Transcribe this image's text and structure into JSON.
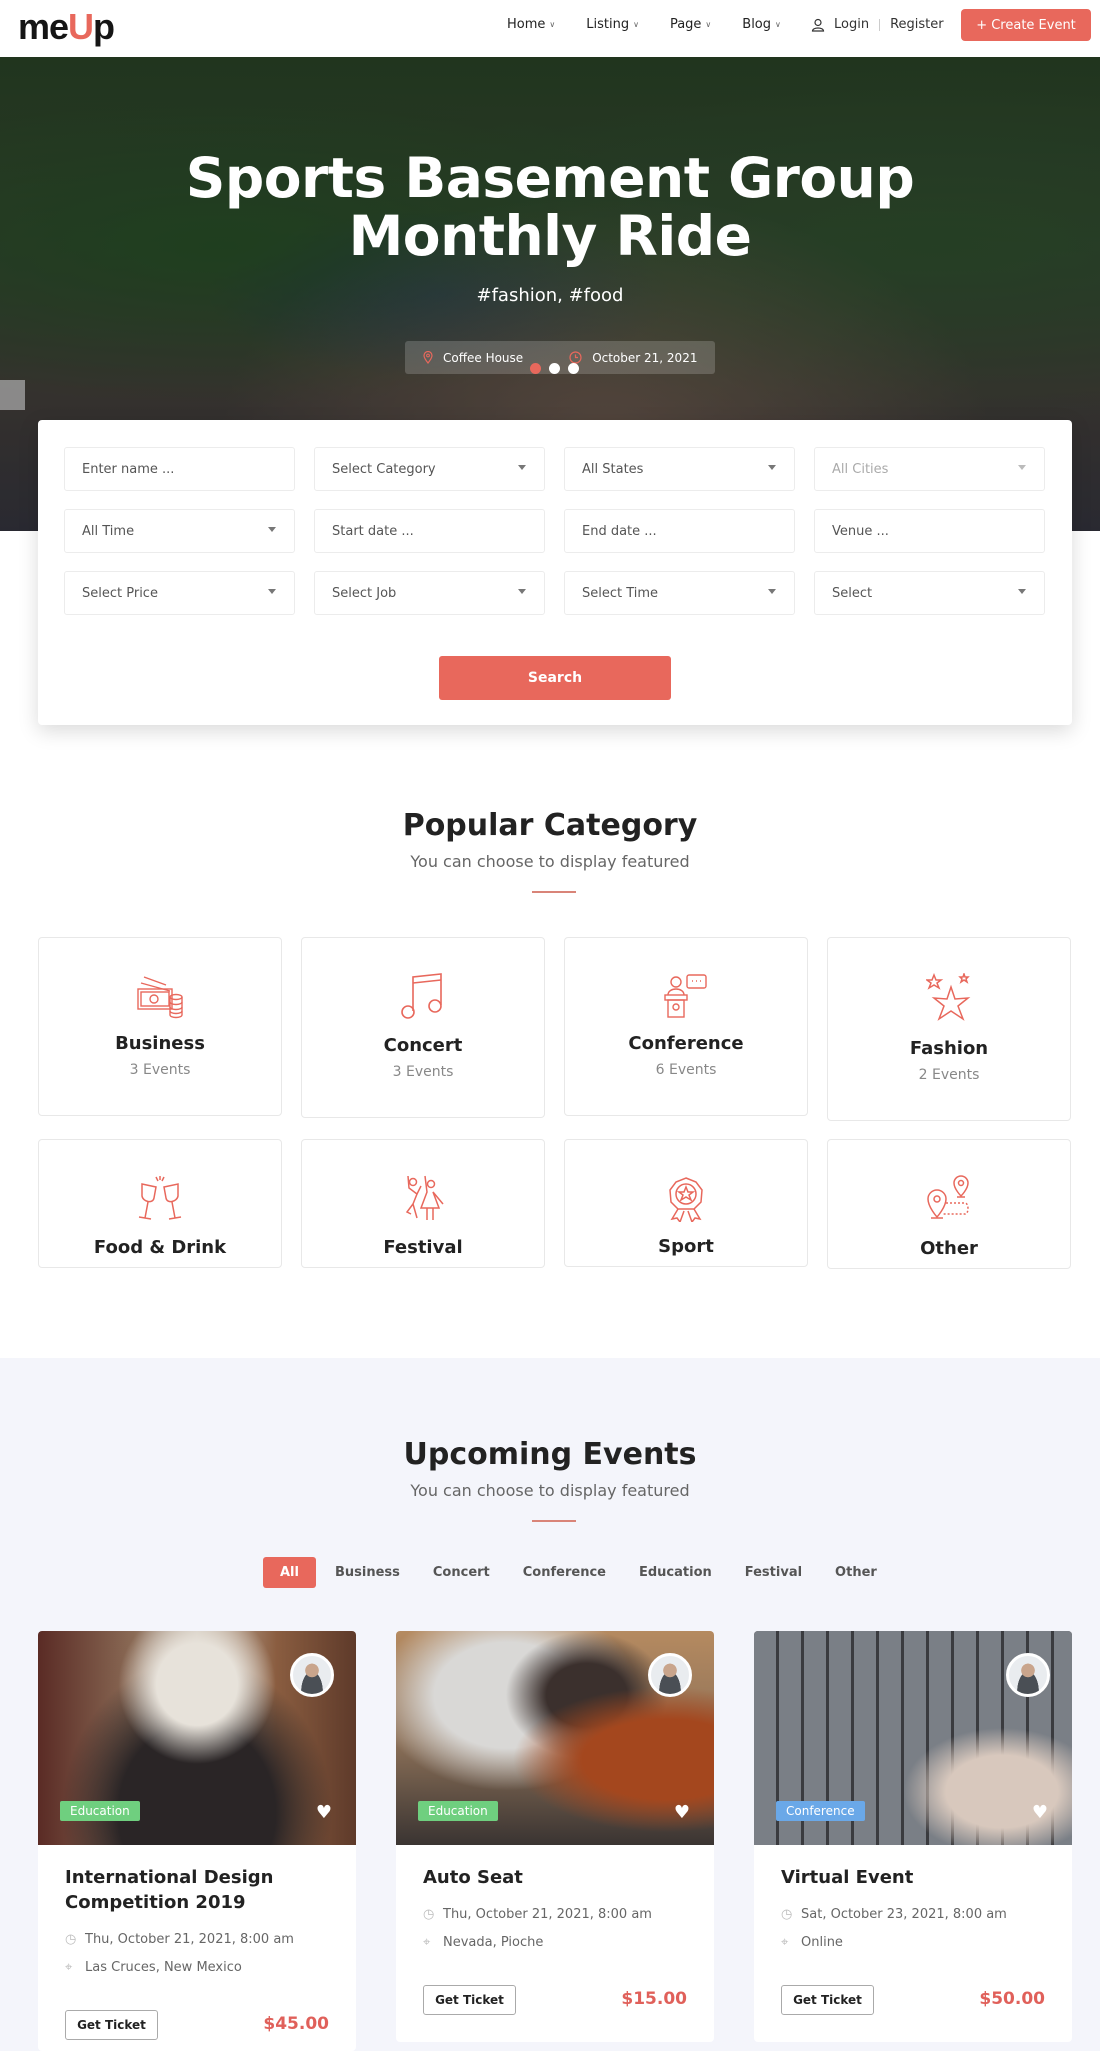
{
  "header": {
    "logo_prefix": "me",
    "logo_accent": "U",
    "logo_suffix": "p",
    "nav": [
      "Home",
      "Listing",
      "Page",
      "Blog"
    ],
    "login": "Login",
    "register": "Register",
    "create_event": "+ Create Event"
  },
  "hero": {
    "title_line1": "Sports Basement Group",
    "title_line2": "Monthly Ride",
    "tags": "#fashion, #food",
    "venue": "Coffee House",
    "date": "October 21, 2021",
    "slides": 3,
    "active_slide": 1
  },
  "search": {
    "fields": [
      {
        "label": "Enter name ...",
        "type": "input"
      },
      {
        "label": "Select Category",
        "type": "select"
      },
      {
        "label": "All States",
        "type": "select"
      },
      {
        "label": "All Cities",
        "type": "select",
        "disabled": true
      },
      {
        "label": "All Time",
        "type": "select"
      },
      {
        "label": "Start date ...",
        "type": "input"
      },
      {
        "label": "End date ...",
        "type": "input"
      },
      {
        "label": "Venue ...",
        "type": "input"
      },
      {
        "label": "Select Price",
        "type": "select"
      },
      {
        "label": "Select Job",
        "type": "select"
      },
      {
        "label": "Select Time",
        "type": "select"
      },
      {
        "label": "Select",
        "type": "select"
      }
    ],
    "button": "Search"
  },
  "popular": {
    "title": "Popular Category",
    "subtitle": "You can choose to display featured",
    "categories": [
      {
        "name": "Business",
        "count": "3 Events",
        "icon": "money-coins-icon"
      },
      {
        "name": "Concert",
        "count": "3 Events",
        "icon": "music-note-icon"
      },
      {
        "name": "Conference",
        "count": "6 Events",
        "icon": "speaker-podium-icon"
      },
      {
        "name": "Fashion",
        "count": "2 Events",
        "icon": "stars-icon"
      },
      {
        "name": "Food & Drink",
        "count": "",
        "icon": "wine-glasses-icon"
      },
      {
        "name": "Festival",
        "count": "",
        "icon": "dancers-icon"
      },
      {
        "name": "Sport",
        "count": "",
        "icon": "medal-icon"
      },
      {
        "name": "Other",
        "count": "",
        "icon": "map-pins-icon"
      }
    ]
  },
  "upcoming": {
    "title": "Upcoming Events",
    "subtitle": "You can choose to display featured",
    "filters": [
      "All",
      "Business",
      "Concert",
      "Conference",
      "Education",
      "Festival",
      "Other"
    ],
    "active_filter": "All",
    "events": [
      {
        "title": "International Design Competition 2019",
        "badge": "Education",
        "badge_color": "#6fcf7f",
        "date": "Thu, October 21, 2021, 8:00 am",
        "location": "Las Cruces, New Mexico",
        "button": "Get Ticket",
        "price": "$45.00"
      },
      {
        "title": "Auto Seat",
        "badge": "Education",
        "badge_color": "#6fcf7f",
        "date": "Thu, October 21, 2021, 8:00 am",
        "location": "Nevada, Pioche",
        "button": "Get Ticket",
        "price": "$15.00"
      },
      {
        "title": "Virtual Event",
        "badge": "Conference",
        "badge_color": "#6aa8e8",
        "date": "Sat, October 23, 2021, 8:00 am",
        "location": "Online",
        "button": "Get Ticket",
        "price": "$50.00"
      }
    ]
  },
  "colors": {
    "accent": "#e8685c"
  }
}
